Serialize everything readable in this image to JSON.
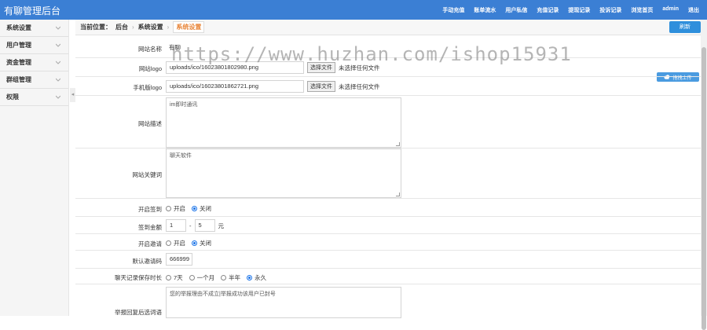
{
  "header": {
    "brand": "有聊管理后台",
    "nav": [
      "手动充值",
      "账单流水",
      "用户私信",
      "充值记录",
      "提现记录",
      "投诉记录",
      "浏览首页",
      "admin",
      "退出"
    ]
  },
  "sidebar": {
    "items": [
      {
        "label": "系统设置"
      },
      {
        "label": "用户管理"
      },
      {
        "label": "资金管理"
      },
      {
        "label": "群组管理"
      },
      {
        "label": "权限"
      }
    ]
  },
  "breadcrumb": {
    "prefix": "当前位置：",
    "home": "后台",
    "section": "系统设置",
    "current": "系统设置"
  },
  "refresh_label": "刷新",
  "upload_tag": "拖拽上传",
  "watermark": "https://www.huzhan.com/ishop15931",
  "form": {
    "site_name": {
      "label": "网站名称",
      "value": "有聊"
    },
    "site_logo": {
      "label": "网站logo",
      "value": "uploads/ico/16023801802980.png",
      "button": "选择文件",
      "status": "未选择任何文件"
    },
    "mobile_logo": {
      "label": "手机版logo",
      "value": "uploads/ico/16023801862721.png",
      "button": "选择文件",
      "status": "未选择任何文件"
    },
    "site_desc": {
      "label": "网站描述",
      "value": "im即时通讯"
    },
    "site_keywords": {
      "label": "网站关键词",
      "value": "聊天软件"
    },
    "checkin": {
      "label": "开启签到",
      "options": [
        "开启",
        "关闭"
      ],
      "selected": 1
    },
    "checkin_amount": {
      "label": "签到金额",
      "min": "1",
      "sep": "-",
      "max": "5",
      "unit": "元"
    },
    "invite": {
      "label": "开启邀请",
      "options": [
        "开启",
        "关闭"
      ],
      "selected": 1
    },
    "invite_code": {
      "label": "默认邀请码",
      "value": "666999"
    },
    "chat_retention": {
      "label": "聊天记录保存时长",
      "options": [
        "7天",
        "一个月",
        "半年",
        "永久"
      ],
      "selected": 3
    },
    "report_reply": {
      "label": "举报回复后选词语",
      "value": "您的举报理由不成立|举报成功该用户已封号"
    }
  }
}
